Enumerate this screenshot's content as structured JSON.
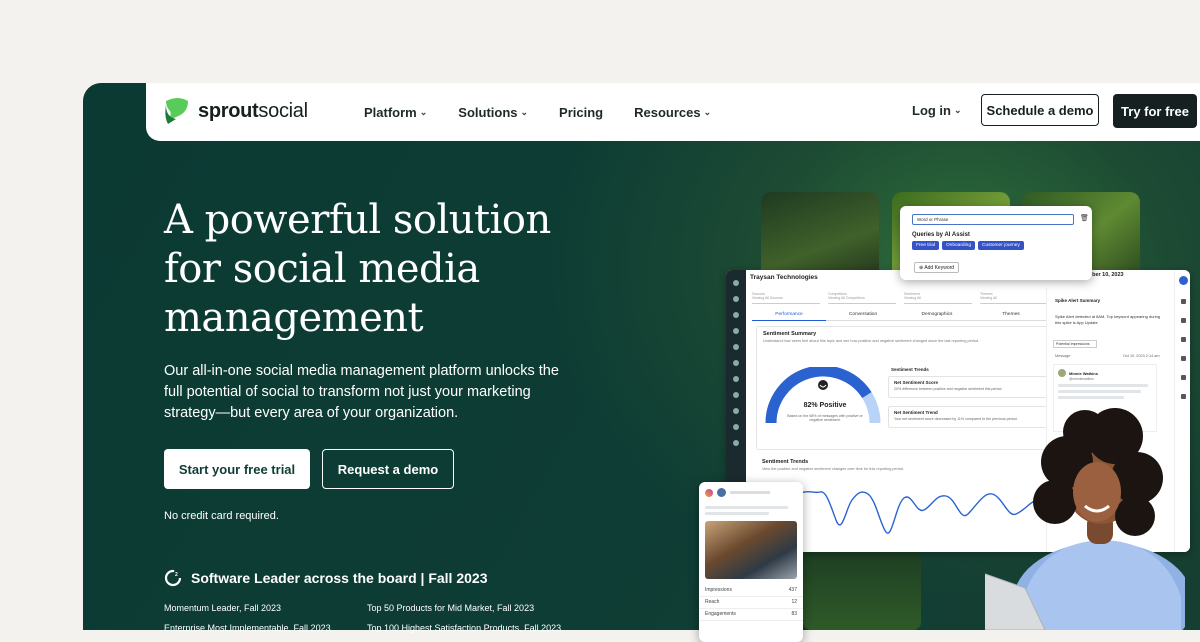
{
  "brand": {
    "name_part1": "sprout",
    "name_part2": "social",
    "green": "#59cb59",
    "dark": "#162020"
  },
  "nav": {
    "links": [
      {
        "label": "Platform",
        "has_menu": true
      },
      {
        "label": "Solutions",
        "has_menu": true
      },
      {
        "label": "Pricing",
        "has_menu": false
      },
      {
        "label": "Resources",
        "has_menu": true
      }
    ],
    "login": "Log in",
    "demo": "Schedule a demo",
    "try": "Try for free"
  },
  "hero": {
    "title": "A powerful solution for social media management",
    "description": "Our all-in-one social media management platform unlocks the full potential of social to transform not just your marketing strategy—but every area of your organization.",
    "primary_cta": "Start your free trial",
    "secondary_cta": "Request a demo",
    "note": "No credit card required."
  },
  "awards": {
    "headline": "Software Leader across the board | Fall 2023",
    "items": [
      "Momentum Leader, Fall 2023",
      "Top 50 Products for Mid Market, Fall 2023",
      "Enterprise Most Implementable, Fall 2023",
      "Top 100 Highest Satisfaction Products, Fall 2023"
    ]
  },
  "dashboard": {
    "company": "Traysan Technologies",
    "date": "Tuesday, October 10, 2023",
    "filters": [
      {
        "label": "Sources",
        "value": "Viewing All Sources"
      },
      {
        "label": "Competitors",
        "value": "Viewing All Competitors"
      },
      {
        "label": "Sentiment",
        "value": "Viewing All"
      },
      {
        "label": "Themes",
        "value": "Viewing All"
      }
    ],
    "tabs": [
      "Performance",
      "Conversation",
      "Demographics",
      "Themes"
    ],
    "sentiment_summary": {
      "title": "Sentiment Summary",
      "subtitle": "Understand how users feel about this topic and see how positive and negative sentiment changed since the last reporting period.",
      "percent": 82,
      "label": "82% Positive",
      "note": "Based on the 68% of messages with positive or negative sentiment."
    },
    "sentiment_trends_heading": "Sentiment Trends",
    "trends": [
      {
        "title": "Net Sentiment Score",
        "text": "20% difference between positive and negative sentiment this period."
      },
      {
        "title": "Net Sentiment Trend",
        "text": "Your net sentiment score decreased by 11% compared to the previous period."
      }
    ],
    "trends_chart": {
      "title": "Sentiment Trends",
      "subtitle": "View the positive and negative sentiment changes over time for this reporting period."
    },
    "alert": {
      "title": "Spike Alert Summary",
      "text": "Spike Alert detected at 8AM. Top keyword appearing during this spike is App Update",
      "select": "Potential Impressions",
      "col1": "Message",
      "col2": "Oct 10, 2023 2:14 am",
      "user": "Minnie Watkins",
      "handle": "@minniewatkins"
    }
  },
  "popup": {
    "select": "Word or Phrase",
    "heading": "Queries by AI Assist",
    "chips": [
      "Free trial",
      "Onboarding",
      "Customer journey"
    ],
    "add": "Add Keyword"
  },
  "mobile": {
    "rows": [
      {
        "label": "Impressions",
        "value": "437"
      },
      {
        "label": "Reach",
        "value": "12"
      },
      {
        "label": "Engagements",
        "value": "83"
      }
    ]
  }
}
